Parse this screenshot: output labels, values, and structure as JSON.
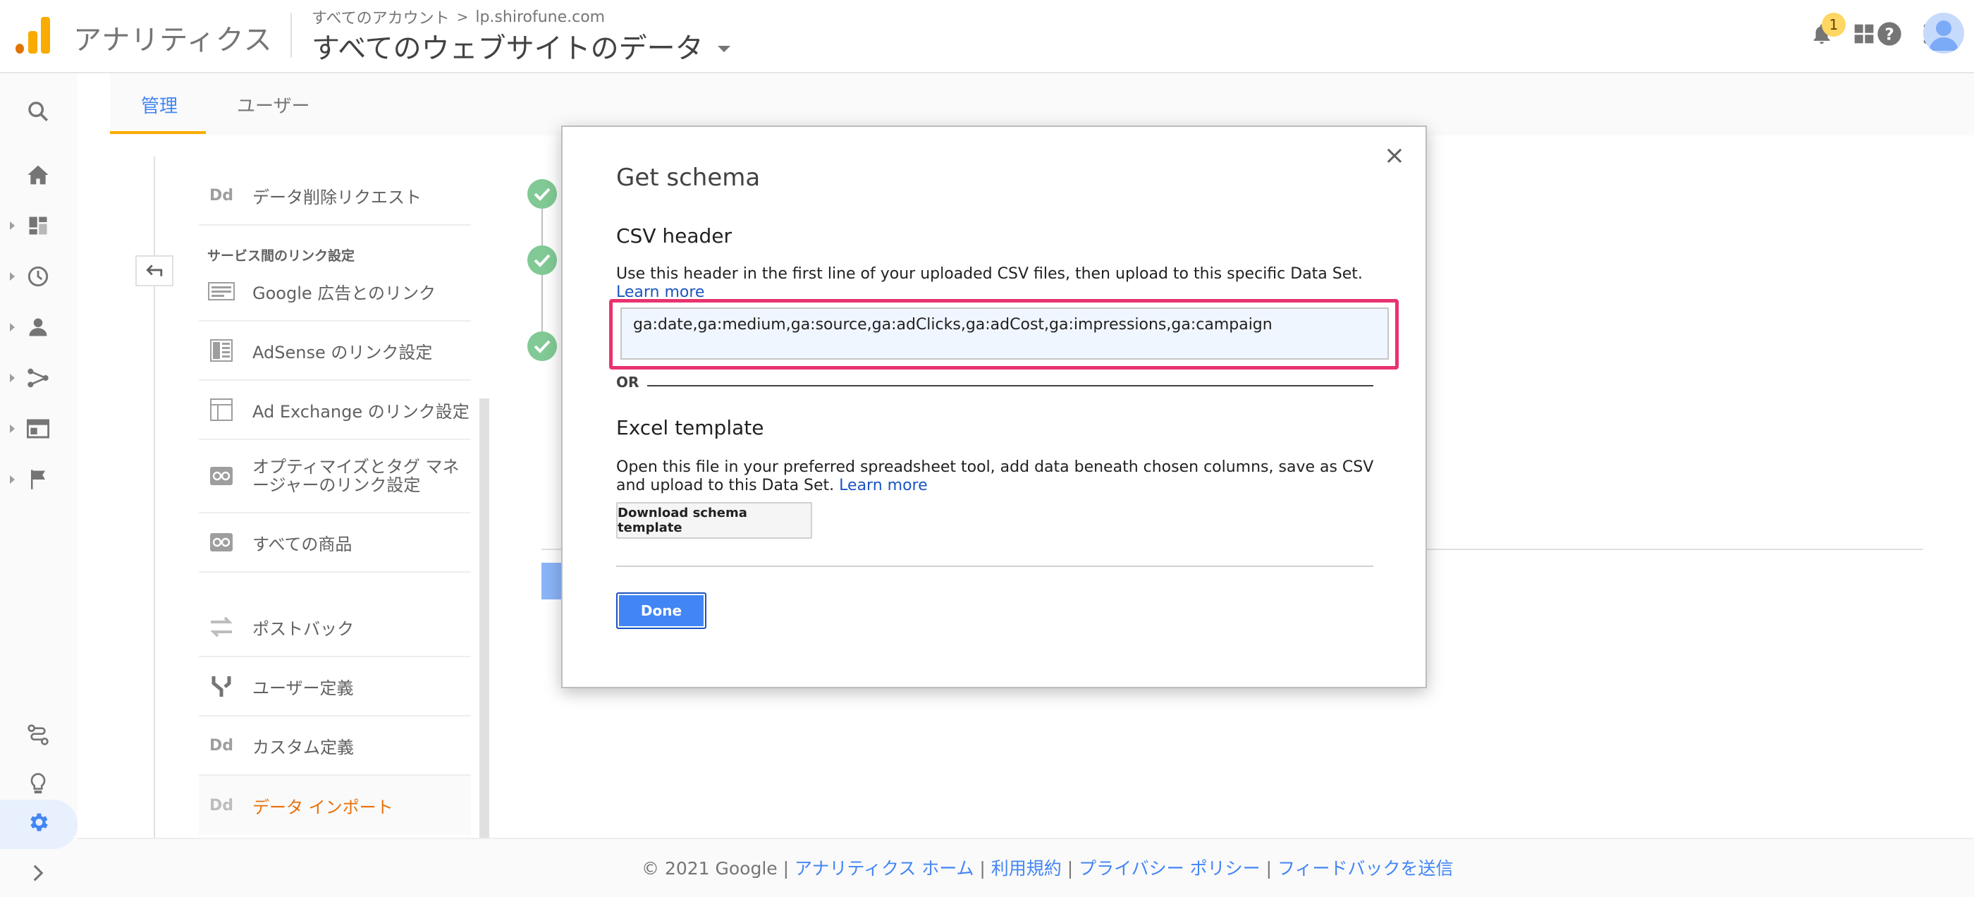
{
  "topbar": {
    "app_name": "アナリティクス",
    "breadcrumb_account": "すべてのアカウント",
    "breadcrumb_sep": ">",
    "breadcrumb_property": "lp.shirofune.com",
    "view_title": "すべてのウェブサイトのデータ",
    "notification_count": "1",
    "icons": [
      "notifications-icon",
      "apps-grid-icon",
      "help-icon",
      "more-vert-icon",
      "avatar"
    ]
  },
  "rail": {
    "icons": [
      "search-icon",
      "home-icon",
      "customization-icon",
      "realtime-icon",
      "audience-icon",
      "acquisition-icon",
      "behavior-icon",
      "conversions-icon",
      "attribution-icon",
      "discover-icon",
      "admin-gear-icon",
      "expand-icon"
    ]
  },
  "tabs": [
    {
      "label": "管理",
      "active": true
    },
    {
      "label": "ユーザー",
      "active": false
    }
  ],
  "property_menu": {
    "section_heading": "サービス間のリンク設定",
    "items": [
      {
        "label": "データ削除リクエスト",
        "icon": "dd-icon"
      },
      {
        "label": "Google 広告とのリンク",
        "icon": "ads-link-icon"
      },
      {
        "label": "AdSense のリンク設定",
        "icon": "adsense-icon"
      },
      {
        "label": "Ad Exchange のリンク設定",
        "icon": "ad-exchange-icon"
      },
      {
        "label": "オプティマイズとタグ マネージャーのリンク設定",
        "icon": "optimize-icon"
      },
      {
        "label": "すべての商品",
        "icon": "all-products-icon"
      },
      {
        "label": "ポストバック",
        "icon": "postback-icon"
      },
      {
        "label": "ユーザー定義",
        "icon": "user-definition-icon"
      },
      {
        "label": "カスタム定義",
        "icon": "dd-icon"
      },
      {
        "label": "データ インポート",
        "icon": "dd-icon",
        "active": true
      }
    ]
  },
  "modal": {
    "title": "Get schema",
    "csv_heading": "CSV header",
    "csv_description": "Use this header in the first line of your uploaded CSV files, then upload to this specific Data Set.",
    "learn_more": "Learn more",
    "csv_value": "ga:date,ga:medium,ga:source,ga:adClicks,ga:adCost,ga:impressions,ga:campaign",
    "or_label": "OR",
    "excel_heading": "Excel template",
    "excel_description": "Open this file in your preferred spreadsheet tool, add data beneath chosen columns, save as CSV and upload to this Data Set.",
    "download_button": "Download schema template",
    "done_button": "Done",
    "close_symbol": "×"
  },
  "footer": {
    "copyright": "© 2021 Google |",
    "links": [
      "アナリティクス ホーム",
      "利用規約",
      "プライバシー ポリシー",
      "フィードバックを送信"
    ],
    "separator": "|"
  },
  "colors": {
    "accent_blue": "#4285f4",
    "highlight_pink": "#e8336f",
    "active_orange": "#e8710a",
    "check_green": "#81c995"
  }
}
